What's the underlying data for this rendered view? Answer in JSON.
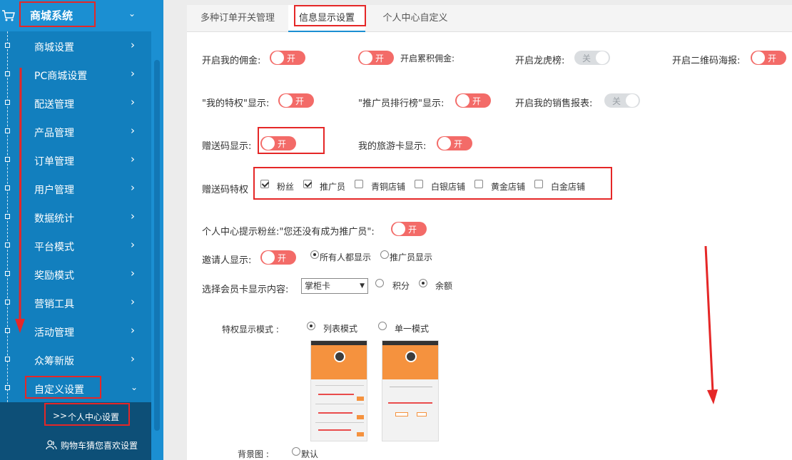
{
  "sidebar": {
    "header": {
      "title": "商城系统",
      "icon": "cart-icon"
    },
    "items": [
      {
        "label": "商城设置"
      },
      {
        "label": "PC商城设置"
      },
      {
        "label": "配送管理"
      },
      {
        "label": "产品管理"
      },
      {
        "label": "订单管理"
      },
      {
        "label": "用户管理"
      },
      {
        "label": "数据统计"
      },
      {
        "label": "平台模式"
      },
      {
        "label": "奖励模式"
      },
      {
        "label": "营销工具"
      },
      {
        "label": "活动管理"
      },
      {
        "label": "众筹新版"
      },
      {
        "label": "自定义设置"
      }
    ],
    "sub_items": [
      {
        "label": "个人中心设置",
        "prefix": ">>"
      },
      {
        "label": "购物车猜您喜欢设置"
      }
    ]
  },
  "tabs": [
    {
      "label": "多种订单开关管理"
    },
    {
      "label": "信息显示设置"
    },
    {
      "label": "个人中心自定义"
    }
  ],
  "settings": {
    "commission": {
      "label": "开启我的佣金:",
      "state": "开"
    },
    "accumulated_commission": {
      "label": "开启累积佣金:",
      "state": "开"
    },
    "leaderboard": {
      "label": "开启龙虎榜:",
      "state": "关"
    },
    "qrcode_poster": {
      "label": "开启二维码海报:",
      "state": "开"
    },
    "my_privilege": {
      "label": "\"我的特权\"显示:",
      "state": "开"
    },
    "promoter_ranking": {
      "label": "\"推广员排行榜\"显示:",
      "state": "开"
    },
    "sales_report": {
      "label": "开启我的销售报表:",
      "state": "关"
    },
    "gift_code": {
      "label": "赠送码显示:",
      "state": "开"
    },
    "travel_card": {
      "label": "我的旅游卡显示:",
      "state": "开"
    },
    "gift_code_privilege": {
      "label": "赠送码特权",
      "options": [
        {
          "label": "粉丝",
          "checked": true
        },
        {
          "label": "推广员",
          "checked": true
        },
        {
          "label": "青铜店铺",
          "checked": false
        },
        {
          "label": "白银店铺",
          "checked": false
        },
        {
          "label": "黄金店铺",
          "checked": false
        },
        {
          "label": "白金店铺",
          "checked": false
        }
      ]
    },
    "fans_prompt": {
      "label": "个人中心提示粉丝:\"您还没有成为推广员\":",
      "state": "开"
    },
    "inviter": {
      "label": "邀请人显示:",
      "state": "开",
      "options": [
        {
          "label": "所有人都显示",
          "checked": true
        },
        {
          "label": "推广员显示",
          "checked": false
        }
      ]
    },
    "member_card": {
      "label": "选择会员卡显示内容:",
      "select_value": "掌柜卡",
      "options": [
        {
          "label": "积分",
          "checked": false
        },
        {
          "label": "余额",
          "checked": true
        }
      ]
    },
    "privilege_mode": {
      "label": "特权显示模式 :",
      "options": [
        {
          "label": "列表模式",
          "checked": true
        },
        {
          "label": "单一模式",
          "checked": false
        }
      ]
    },
    "background": {
      "label": "背景图 :",
      "options": [
        {
          "label": "默认",
          "checked": false
        }
      ]
    }
  },
  "colors": {
    "sidebar": "#127fbe",
    "toggle_on": "#f36b68",
    "toggle_off": "#dadde0",
    "annotation_red": "#e52727",
    "tab_active": "#1b8fd2"
  }
}
